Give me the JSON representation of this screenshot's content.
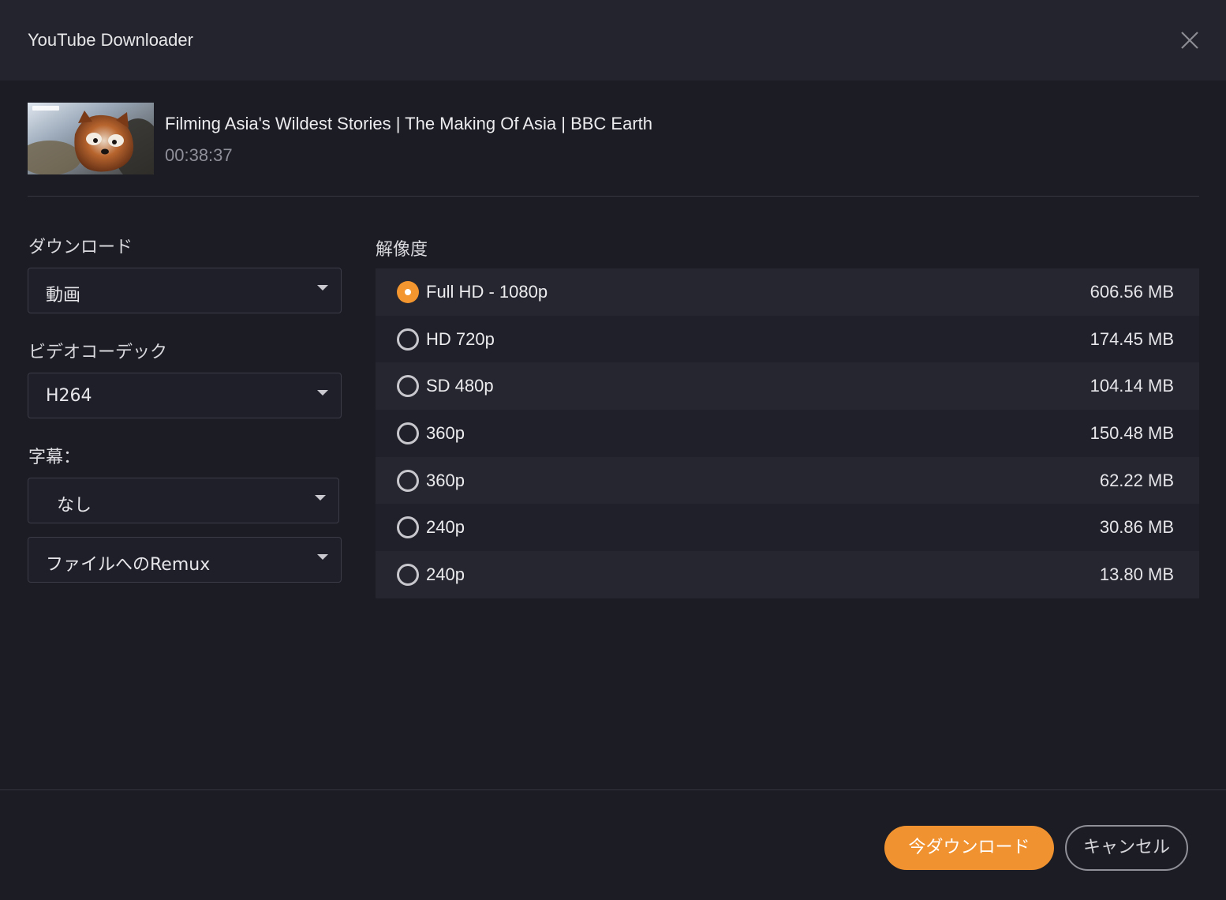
{
  "window": {
    "title": "YouTube Downloader",
    "close_icon": "close-icon"
  },
  "video": {
    "title": "Filming Asia's Wildest Stories | The Making Of Asia | BBC Earth",
    "duration": "00:38:37"
  },
  "options": {
    "download_label": "ダウンロード",
    "download_value": "動画",
    "codec_label": "ビデオコーデック",
    "codec_value": "H264",
    "subtitle_label": "字幕：",
    "subtitle_value": "なし",
    "remux_value": "ファイルへのRemux"
  },
  "resolution": {
    "label": "解像度",
    "selected_index": 0,
    "items": [
      {
        "name": "Full HD - 1080p",
        "size": "606.56 MB"
      },
      {
        "name": "HD 720p",
        "size": "174.45 MB"
      },
      {
        "name": "SD 480p",
        "size": "104.14 MB"
      },
      {
        "name": "360p",
        "size": "150.48 MB"
      },
      {
        "name": "360p",
        "size": "62.22 MB"
      },
      {
        "name": "240p",
        "size": "30.86 MB"
      },
      {
        "name": "240p",
        "size": "13.80 MB"
      }
    ]
  },
  "actions": {
    "download_now": "今ダウンロード",
    "cancel": "キャンセル"
  },
  "colors": {
    "accent": "#f0922f",
    "background": "#1b1c24",
    "titlebar": "#23242d"
  }
}
